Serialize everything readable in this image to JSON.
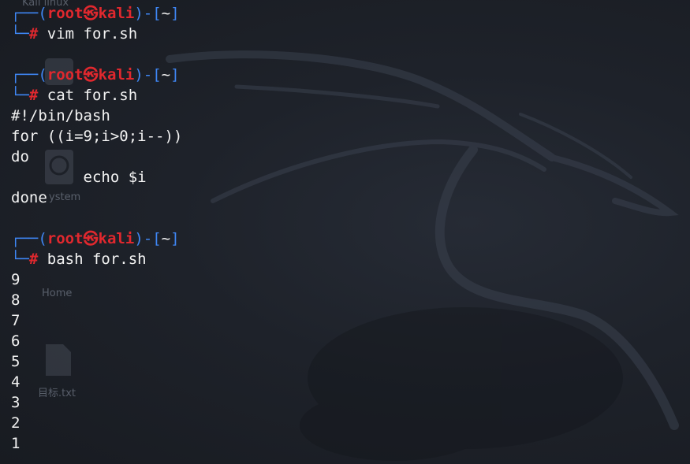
{
  "desktop": {
    "icons": [
      {
        "label": "Kali linux",
        "icon": "folder-icon"
      },
      {
        "label": "ystem",
        "icon": "disk-icon"
      },
      {
        "label": "Home",
        "icon": "home-folder-icon"
      },
      {
        "label": "目标.txt",
        "icon": "text-file-icon"
      }
    ]
  },
  "terminal": {
    "prompt": {
      "open_corner": "┌──(",
      "user": "root",
      "at_symbol": "㉿",
      "host": "kali",
      "close_open": ")-[",
      "path": "~",
      "close_bracket": "]",
      "second_corner": "└─",
      "hash": "#"
    },
    "blocks": [
      {
        "command": "vim for.sh",
        "output": []
      },
      {
        "command": "cat for.sh",
        "output": [
          "#!/bin/bash",
          "for ((i=9;i>0;i--))",
          "do",
          "        echo $i",
          "done"
        ]
      },
      {
        "command": "bash for.sh",
        "output": [
          "9",
          "8",
          "7",
          "6",
          "5",
          "4",
          "3",
          "2",
          "1"
        ]
      }
    ]
  },
  "colors": {
    "prompt_frame": "#3f87f5",
    "prompt_user_host": "#e0282e",
    "text": "#f2f2f2",
    "background": "#1c1f26"
  }
}
